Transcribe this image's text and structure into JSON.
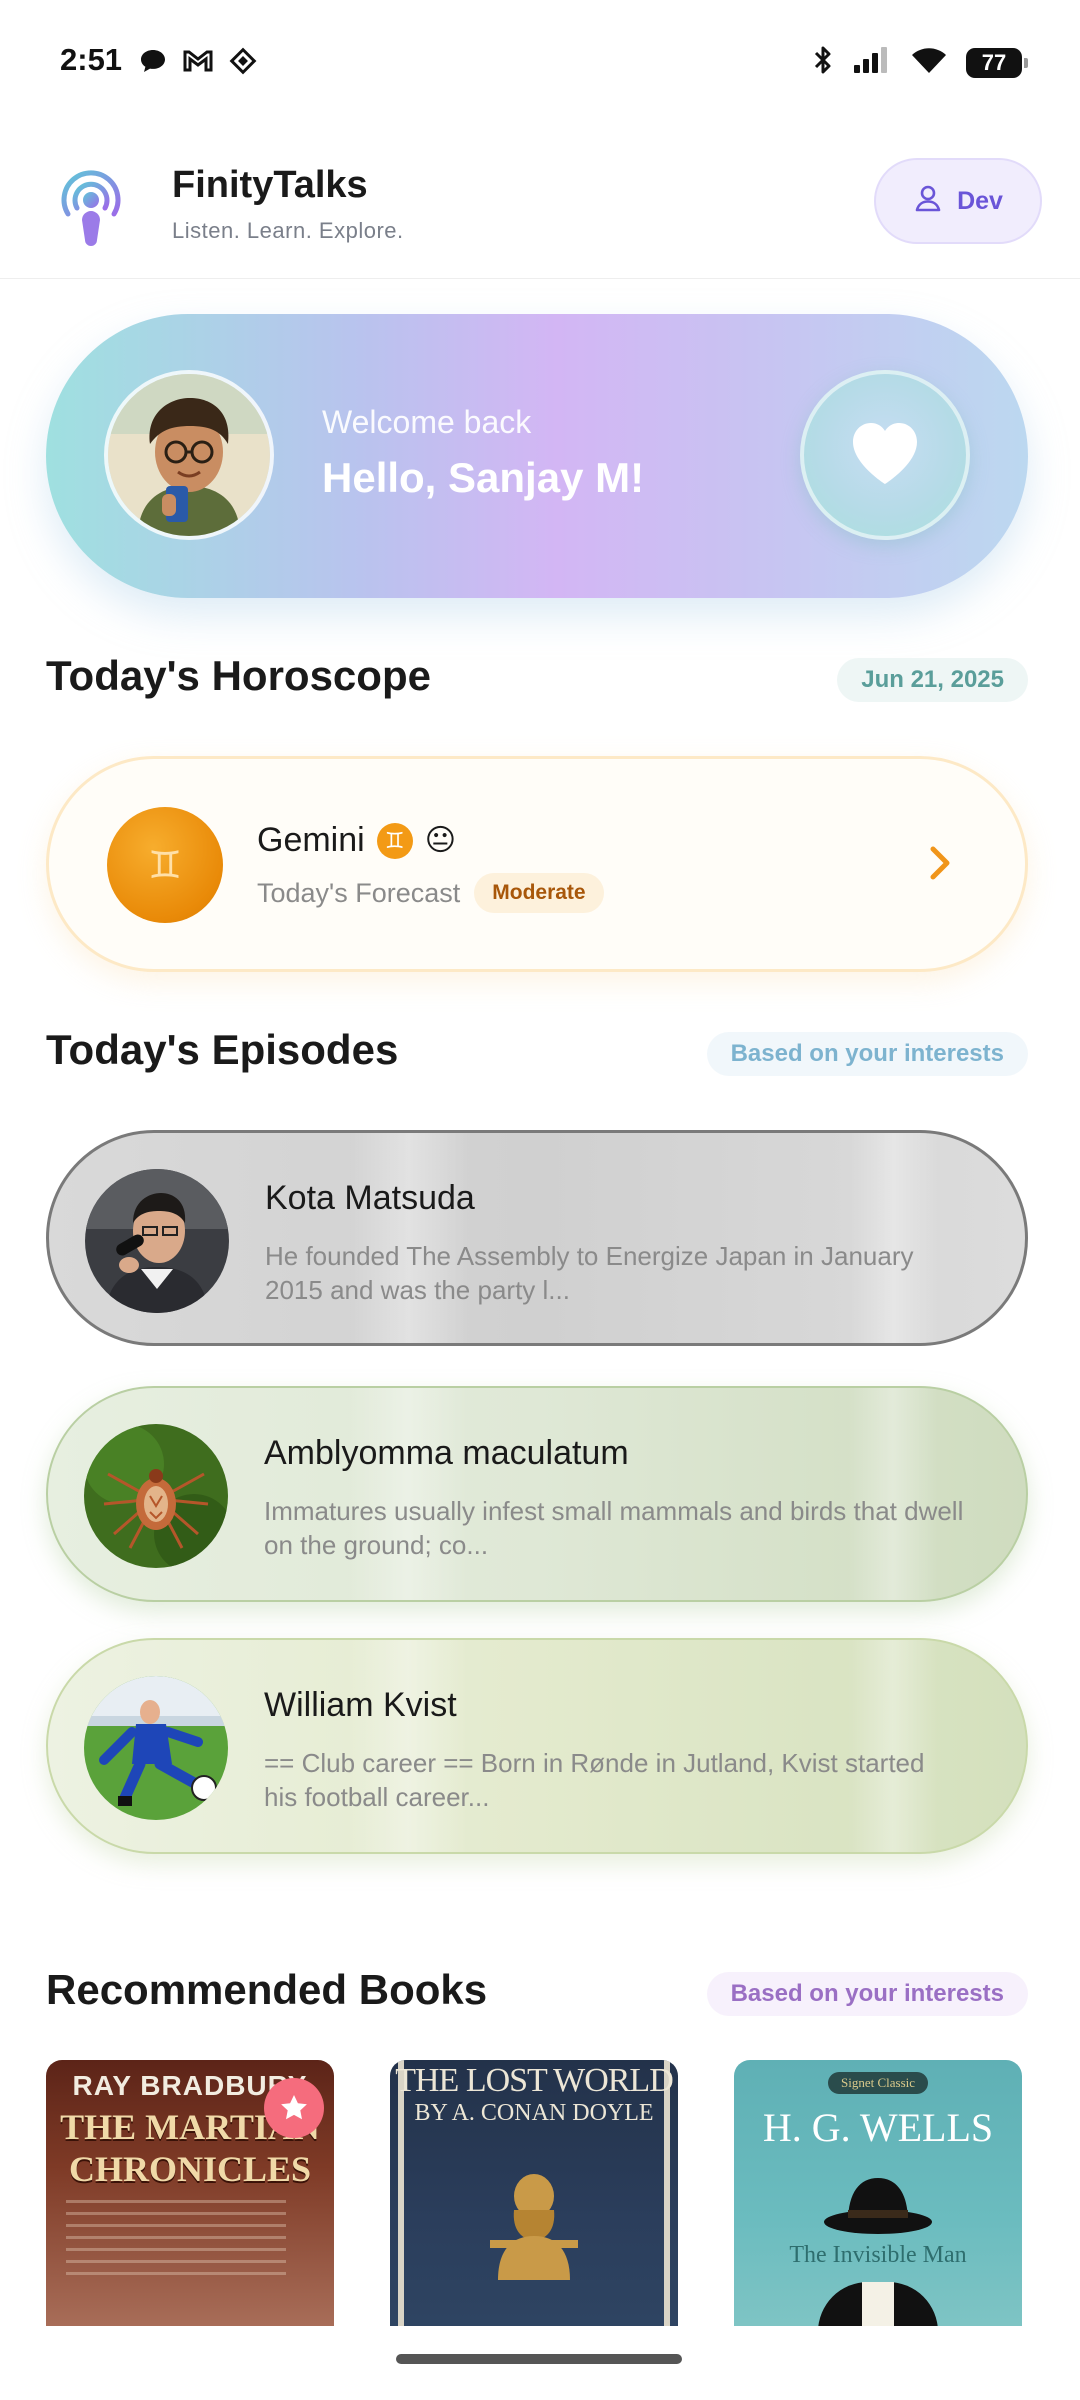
{
  "status_bar": {
    "time": "2:51",
    "battery": "77",
    "notification_icons": [
      "chat-bubble-icon",
      "gmail-icon",
      "diamond-app-icon"
    ],
    "system_icons": [
      "bluetooth-icon",
      "cellular-signal-icon",
      "wifi-icon",
      "battery-icon"
    ]
  },
  "header": {
    "app_name": "FinityTalks",
    "tagline": "Listen. Learn. Explore.",
    "dev_label": "Dev"
  },
  "welcome": {
    "greeting_small": "Welcome back",
    "greeting_big": "Hello, Sanjay M!"
  },
  "horoscope": {
    "section_title": "Today's Horoscope",
    "date": "Jun 21, 2025",
    "sign_name": "Gemini",
    "sign_symbol": "♊",
    "mood_emoji": "😐",
    "forecast_label": "Today's Forecast",
    "forecast_level": "Moderate"
  },
  "episodes": {
    "section_title": "Today's Episodes",
    "tag": "Based on your interests",
    "items": [
      {
        "title": "Kota Matsuda",
        "description": "He founded The Assembly to Energize Japan in January 2015 and was the party l..."
      },
      {
        "title": "Amblyomma maculatum",
        "description": "Immatures usually infest small mammals and birds that dwell on the ground; co..."
      },
      {
        "title": "William Kvist",
        "description": "== Club career == Born in Rønde in Jutland, Kvist started his football career..."
      }
    ]
  },
  "books": {
    "section_title": "Recommended Books",
    "tag": "Based on your interests",
    "items": [
      {
        "author": "RAY BRADBURY",
        "title_line1": "THE MARTIAN",
        "title_line2": "CHRONICLES"
      },
      {
        "title_line1": "THE LOST WORLD",
        "author": "BY A. CONAN DOYLE"
      },
      {
        "publisher": "Signet Classic",
        "author": "H. G. WELLS",
        "title": "The Invisible Man"
      }
    ]
  },
  "colors": {
    "accent_purple": "#6a55d8",
    "horoscope_orange": "#e98a08",
    "date_pill_text": "#5a9e9a",
    "episodes_tag_text": "#7db3cf",
    "books_tag_text": "#9a6fc4"
  }
}
